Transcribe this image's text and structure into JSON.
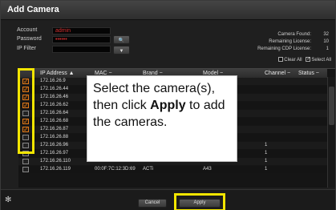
{
  "dialog": {
    "title": "Add Camera"
  },
  "form": {
    "account_label": "Account",
    "account_value": "admin",
    "password_label": "Password",
    "password_value": "••••••",
    "ipfilter_label": "IP Filter",
    "ipfilter_value": ""
  },
  "buttons": {
    "search_icon": "🔍",
    "filter_icon": "▼"
  },
  "stats": {
    "found_label": "Camera Found:",
    "found_value": "32",
    "remaining_label": "Remaining License:",
    "remaining_value": "10",
    "cdp_label": "Remaining CDP License:",
    "cdp_value": "1"
  },
  "options": {
    "clear_all": "Clear All",
    "select_all": "Select All"
  },
  "table": {
    "headers": {
      "ip": "IP Address ▲",
      "mac": "MAC −",
      "brand": "Brand −",
      "model": "Model −",
      "channel": "Channel −",
      "status": "Status −"
    },
    "rows": [
      {
        "checked": true,
        "ip": "172.16.26.9",
        "mac": "",
        "brand": "",
        "model": "",
        "channel": ""
      },
      {
        "checked": true,
        "ip": "172.16.26.44",
        "mac": "",
        "brand": "",
        "model": "",
        "channel": ""
      },
      {
        "checked": true,
        "ip": "172.16.26.46",
        "mac": "",
        "brand": "",
        "model": "",
        "channel": ""
      },
      {
        "checked": true,
        "ip": "172.16.26.62",
        "mac": "",
        "brand": "",
        "model": "",
        "channel": ""
      },
      {
        "checked": false,
        "ip": "172.16.26.64",
        "mac": "",
        "brand": "",
        "model": "",
        "channel": ""
      },
      {
        "checked": true,
        "ip": "172.16.26.68",
        "mac": "",
        "brand": "",
        "model": "",
        "channel": ""
      },
      {
        "checked": true,
        "ip": "172.16.26.87",
        "mac": "",
        "brand": "",
        "model": "",
        "channel": ""
      },
      {
        "checked": false,
        "ip": "172.16.26.88",
        "mac": "",
        "brand": "",
        "model": "",
        "channel": ""
      },
      {
        "checked": false,
        "ip": "172.16.26.96",
        "mac": "00:0F:7C:10:DE:F6",
        "brand": "ACTi",
        "model": "E936",
        "channel": "1"
      },
      {
        "checked": false,
        "ip": "172.16.26.97",
        "mac": "00:0F:7C:0C:20:6E",
        "brand": "ACTi",
        "model": "B67",
        "channel": "1"
      },
      {
        "checked": false,
        "ip": "172.16.26.110",
        "mac": "00:0F:7C:12:2A:30",
        "brand": "ACTi",
        "model": "B59A",
        "channel": "1"
      },
      {
        "checked": false,
        "ip": "172.16.26.119",
        "mac": "00:0F:7C:12:3D:69",
        "brand": "ACTi",
        "model": "A43",
        "channel": "1"
      }
    ]
  },
  "callout": {
    "line1": "Select the camera(s), then click ",
    "bold": "Apply",
    "line2": " to add the cameras."
  },
  "footer": {
    "cancel_label": "Cancel",
    "apply_label": "Apply"
  },
  "colors": {
    "highlight": "#f2e500",
    "check": "#e57e1d",
    "account_text": "#d42f2f"
  }
}
